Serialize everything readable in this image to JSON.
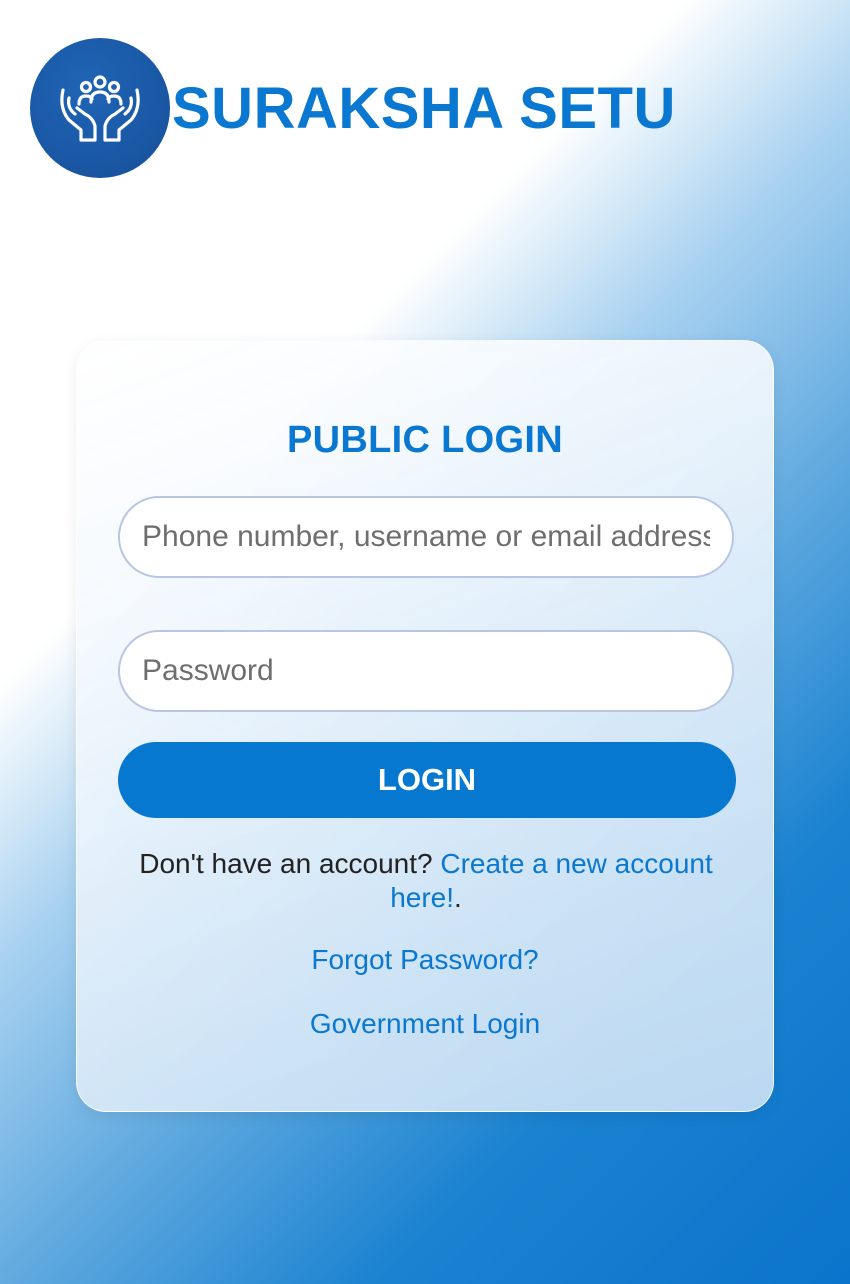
{
  "brand": {
    "logo_icon": "people-in-hands-icon",
    "name": "SURAKSHA SETU"
  },
  "login_form": {
    "title": "PUBLIC LOGIN",
    "username_placeholder": "Phone number, username or email address",
    "password_placeholder": "Password",
    "submit_label": "LOGIN",
    "signup_prompt": "Don't have an account? ",
    "signup_link": "Create a new account here!",
    "signup_suffix": ".",
    "forgot_password_link": "Forgot Password?",
    "government_login_link": "Government Login"
  },
  "colors": {
    "brand_blue": "#0a78d0",
    "button_blue": "#0778d0",
    "logo_circle": "#1a58a5"
  }
}
